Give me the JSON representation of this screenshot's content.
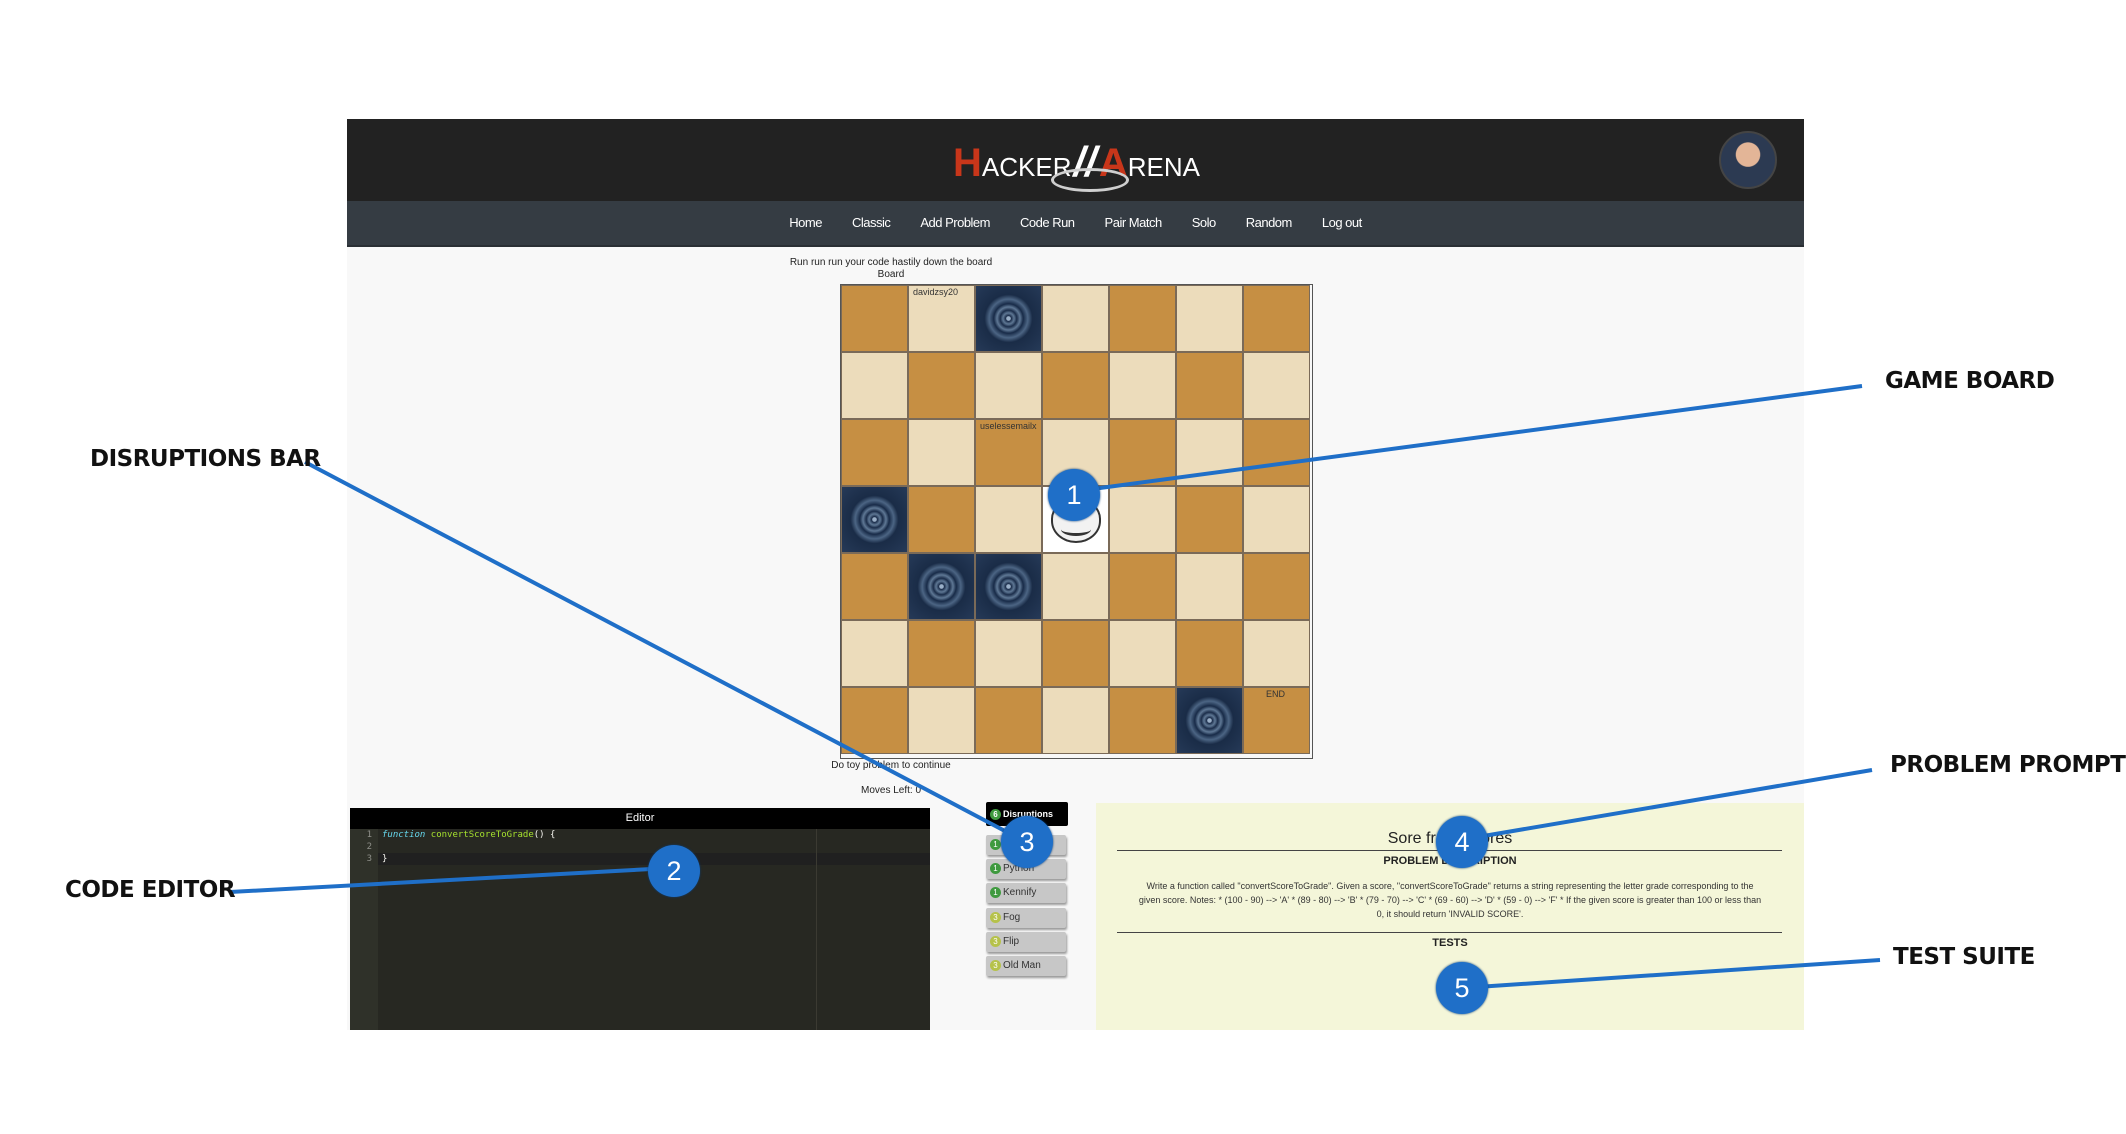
{
  "header": {
    "logo_text_parts": [
      "H",
      "ACKER",
      "//",
      "A",
      "RENA"
    ],
    "logo_alt": "Hacker Arena"
  },
  "nav": {
    "items": [
      "Home",
      "Classic",
      "Add Problem",
      "Code Run",
      "Pair Match",
      "Solo",
      "Random",
      "Log out"
    ]
  },
  "board": {
    "caption_line1": "Run run run your code hastily down the board",
    "caption_line2": "Board",
    "rows": 7,
    "cols": 7,
    "special_cells": [
      {
        "row": 0,
        "col": 1,
        "label": "davidzsy20"
      },
      {
        "row": 2,
        "col": 2,
        "label": "uselessemailx"
      },
      {
        "row": 6,
        "col": 6,
        "label": "END"
      }
    ],
    "portal_cells": [
      [
        0,
        2
      ],
      [
        3,
        0
      ],
      [
        4,
        1
      ],
      [
        4,
        2
      ],
      [
        6,
        5
      ]
    ],
    "player_cell": [
      3,
      3
    ],
    "footer_line1": "Do toy problem to continue",
    "footer_line2": "Moves Left: 0"
  },
  "editor": {
    "title": "Editor",
    "line_numbers": [
      "1",
      "2",
      "3"
    ],
    "code_keyword": "function",
    "code_function_name": "convertScoreToGrade",
    "code_rest_line1": "() {",
    "code_line3": "}"
  },
  "disruptions": {
    "header_count": "6",
    "header_label": "Disruptions",
    "items": [
      {
        "count": "1",
        "label": ""
      },
      {
        "count": "1",
        "label": "Python"
      },
      {
        "count": "1",
        "label": "Kennify"
      },
      {
        "count": "3",
        "label": "Fog"
      },
      {
        "count": "3",
        "label": "Flip"
      },
      {
        "count": "3",
        "label": "Old Man"
      }
    ]
  },
  "problem": {
    "title": "Sore from Scores",
    "subtitle": "PROBLEM DESCRIPTION",
    "description": "Write a function called \"convertScoreToGrade\". Given a score, \"convertScoreToGrade\" returns a string representing the letter grade corresponding to the given score. Notes: * (100 - 90) --> 'A' * (89 - 80) --> 'B' * (79 - 70) --> 'C' * (69 - 60) --> 'D' * (59 - 0) --> 'F' * If the given score is greater than 100 or less than 0, it should return 'INVALID SCORE'.",
    "tests_title": "TESTS"
  },
  "annotations": {
    "labels": {
      "game_board": "GAME BOARD",
      "disruptions_bar": "DISRUPTIONS BAR",
      "code_editor": "CODE EDITOR",
      "problem_prompt": "PROBLEM PROMPT",
      "test_suite": "TEST SUITE"
    },
    "markers": [
      "1",
      "2",
      "3",
      "4",
      "5"
    ],
    "line_color": "#1f6fc8"
  }
}
